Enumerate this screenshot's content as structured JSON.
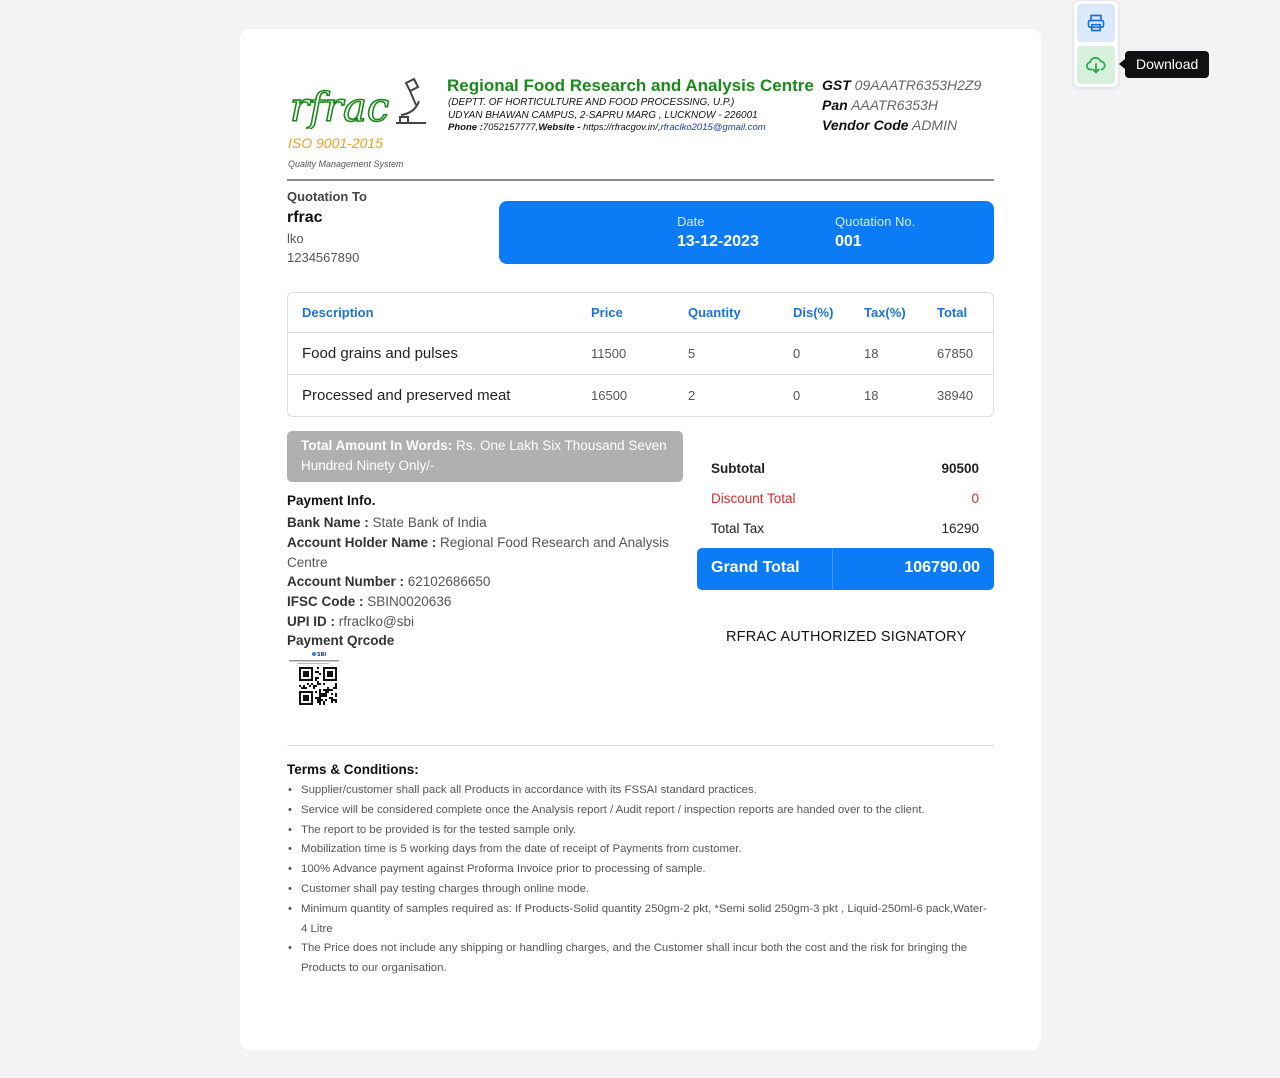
{
  "tooltip": "Download",
  "header": {
    "logo_text": "rfrac",
    "iso": "ISO 9001-2015",
    "qms": "Quality Management System",
    "org_name": "Regional Food Research and Analysis Centre",
    "dept": "(DEPTT. OF HORTICULTURE AND FOOD PROCESSING, U.P.)",
    "address": "UDYAN BHAWAN CAMPUS, 2-SAPRU MARG , LUCKNOW - 226001",
    "phone_label": "Phone :",
    "phone": "7052157777,",
    "website_label": "Website - ",
    "website": "https://rfracgov.in/,",
    "email": "rfraclko2015@gmail.com",
    "gst_label": "GST",
    "gst": "09AAATR6353H2Z9",
    "pan_label": "Pan",
    "pan": "AAATR6353H",
    "vendor_label": "Vendor Code",
    "vendor": "ADMIN"
  },
  "quotation": {
    "to_label": "Quotation To",
    "name": "rfrac",
    "city": "lko",
    "phone": "1234567890",
    "date_label": "Date",
    "date": "13-12-2023",
    "number_label": "Quotation No.",
    "number": "001"
  },
  "table": {
    "headers": [
      "Description",
      "Price",
      "Quantity",
      "Dis(%)",
      "Tax(%)",
      "Total"
    ],
    "rows": [
      [
        "Food grains and pulses",
        "11500",
        "5",
        "0",
        "18",
        "67850"
      ],
      [
        "Processed and preserved meat",
        "16500",
        "2",
        "0",
        "18",
        "38940"
      ]
    ]
  },
  "words": {
    "label": "Total Amount In Words:",
    "value": "Rs. One Lakh Six Thousand Seven Hundred Ninety Only/-"
  },
  "payment": {
    "title": "Payment Info.",
    "bank_label": "Bank Name :",
    "bank": "State Bank of India",
    "holder_label": "Account Holder Name :",
    "holder": "Regional Food Research and Analysis Centre",
    "account_label": "Account Number :",
    "account": "62102686650",
    "ifsc_label": "IFSC Code :",
    "ifsc": "SBIN0020636",
    "upi_label": "UPI ID :",
    "upi": "rfraclko@sbi",
    "qr_label": "Payment Qrcode",
    "qr_brand": "SBI"
  },
  "totals": {
    "subtotal_label": "Subtotal",
    "subtotal": "90500",
    "discount_label": "Discount Total",
    "discount": "0",
    "tax_label": "Total Tax",
    "tax": "16290",
    "grand_label": "Grand Total",
    "grand": "106790.00",
    "discount_color": "#d62b2b"
  },
  "signatory": "RFRAC AUTHORIZED SIGNATORY",
  "terms": {
    "title": "Terms & Conditions:",
    "items": [
      "Supplier/customer shall pack all Products in accordance with its FSSAI standard practices.",
      "Service will be considered complete once the Analysis report / Audit report / inspection reports are handed over to the client.",
      "The report to be provided is for the tested sample only.",
      "Mobilization time is 5 working days from the date of receipt of Payments from customer.",
      "100% Advance payment against Proforma Invoice prior to processing of sample.",
      "Customer shall pay testing charges through online mode.",
      "Minimum quantity of samples required as: If Products-Solid  quantity 250gm-2 pkt, *Semi solid  250gm-3 pkt , Liquid-250ml-6 pack,Water-4 Litre",
      "The Price does not include any shipping or handling charges, and the Customer shall incur both the cost and the risk for bringing the Products to our organisation."
    ]
  },
  "icons": {
    "print": "printer-icon",
    "download": "cloud-download-icon"
  },
  "colors": {
    "accent": "#0b7cf5",
    "org_green": "#1a8a1a",
    "iso_orange": "#e8a317"
  }
}
